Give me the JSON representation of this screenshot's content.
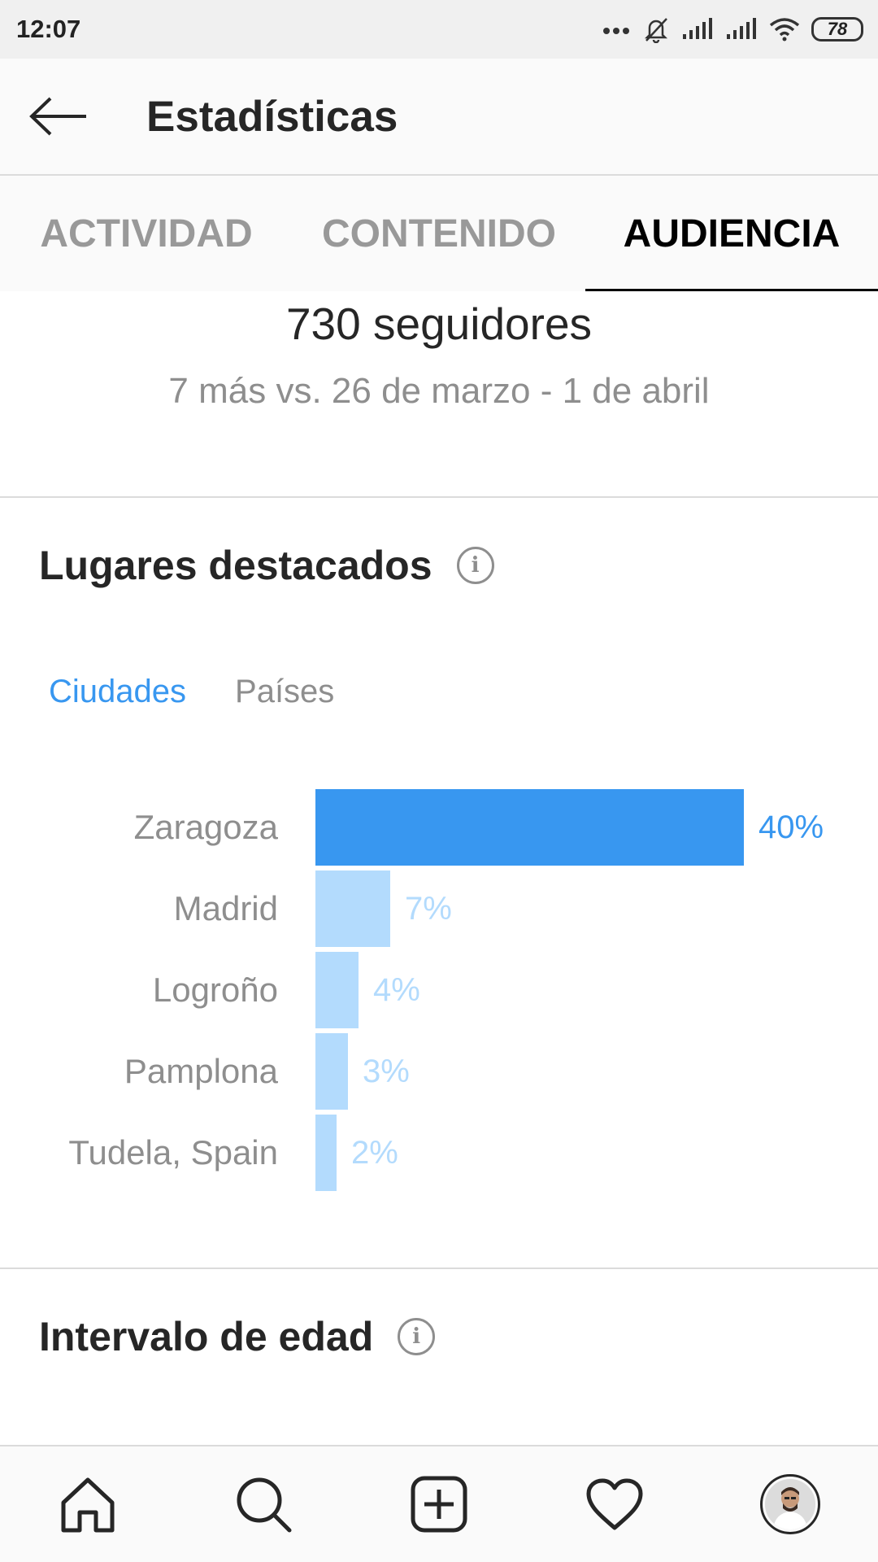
{
  "status_bar": {
    "time": "12:07",
    "battery": "78",
    "icons": [
      "more-dots-icon",
      "bell-muted-icon",
      "signal-icon",
      "signal-icon",
      "wifi-icon",
      "battery-icon"
    ]
  },
  "header": {
    "title": "Estadísticas",
    "back_icon": "back-arrow-icon"
  },
  "tabs": [
    {
      "label": "ACTIVIDAD",
      "active": false
    },
    {
      "label": "CONTENIDO",
      "active": false
    },
    {
      "label": "AUDIENCIA",
      "active": true
    }
  ],
  "followers": {
    "count": "730 seguidores",
    "delta": "7 más  vs. 26 de marzo - 1 de abril"
  },
  "top_locations": {
    "title": "Lugares destacados",
    "info_icon": "i",
    "subtabs": [
      {
        "label": "Ciudades",
        "active": true
      },
      {
        "label": "Países",
        "active": false
      }
    ]
  },
  "chart_data": {
    "type": "bar",
    "orientation": "horizontal",
    "categories": [
      "Zaragoza",
      "Madrid",
      "Logroño",
      "Pamplona",
      "Tudela, Spain"
    ],
    "values": [
      40,
      7,
      4,
      3,
      2
    ],
    "labels": [
      "40%",
      "7%",
      "4%",
      "3%",
      "2%"
    ],
    "highlight_color": "#3897f0",
    "bar_color": "#b3dbfd"
  },
  "age_range": {
    "title": "Intervalo de edad",
    "info_icon": "i"
  },
  "bottom_nav": {
    "items": [
      "home-icon",
      "search-icon",
      "add-post-icon",
      "activity-heart-icon",
      "profile-avatar"
    ]
  }
}
